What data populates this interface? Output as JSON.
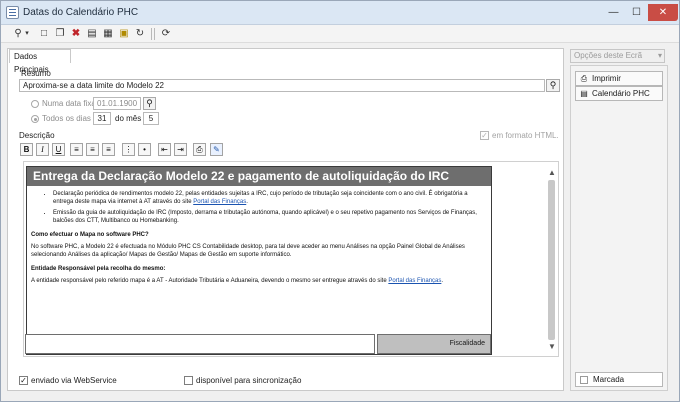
{
  "window": {
    "title": "Datas do Calendário PHC",
    "minimize": "—",
    "maximize": "☐",
    "close": "✕"
  },
  "tab": {
    "label": "Dados Principais"
  },
  "resumo": {
    "label": "Resumo",
    "value": "Aproxima-se a data limite do Modelo 22"
  },
  "schedule": {
    "fixed_label": "Numa data fixa",
    "fixed_date": "01.01.1900",
    "daily_label": "Todos os dias",
    "day": "31",
    "month_label": "do mês",
    "month": "5"
  },
  "descricao": {
    "label": "Descrição",
    "html_label": "em formato HTML."
  },
  "format_buttons": [
    "B",
    "I",
    "U"
  ],
  "doc": {
    "title": "Entrega da Declaração Modelo 22  e pagamento de autoliquidação do IRC",
    "bullet1": "Declaração periódica de rendimentos modelo 22, pelas entidades sujeitas a IRC, cujo período de tributação seja coincidente com o ano civil. É obrigatória a entrega deste mapa via internet à AT através do site ",
    "bullet1_link": "Portal das Finanças",
    "bullet1_end": ".",
    "bullet2": "Emissão da guia de autoliquidação de IRC (Imposto, derrama e tributação autónoma, quando aplicável) e o seu repetivo pagamento nos Serviços de Finanças, balcões dos CTT, Multibanco ou Homebanking.",
    "heading1": "Como efectuar o Mapa no software PHC?",
    "para1": "No software PHC, a Modelo 22 é efectuada no Módulo PHC CS Contabilidade desktop, para tal deve aceder ao menu Análises  na opção Painel Global de Análises selecionando Análises da aplicação/ Mapas de Gestão/ Mapas de Gestão em suporte informático.",
    "heading2": "Entidade Responsável pela recolha do mesmo:",
    "para2": "A entidade responsável pelo referido mapa é a AT - Autoridade Tributária e Aduaneira, devendo o mesmo ser entregue através do site ",
    "para2_link": "Portal das Finanças",
    "para2_end": ".",
    "footer_right": "Fiscalidade"
  },
  "options": {
    "webservice": "enviado via WebService",
    "sync": "disponível para sincronização"
  },
  "side": {
    "header": "Opções deste Ecrã",
    "print": "Imprimir",
    "calendar": "Calendário PHC",
    "marked": "Marcada"
  }
}
